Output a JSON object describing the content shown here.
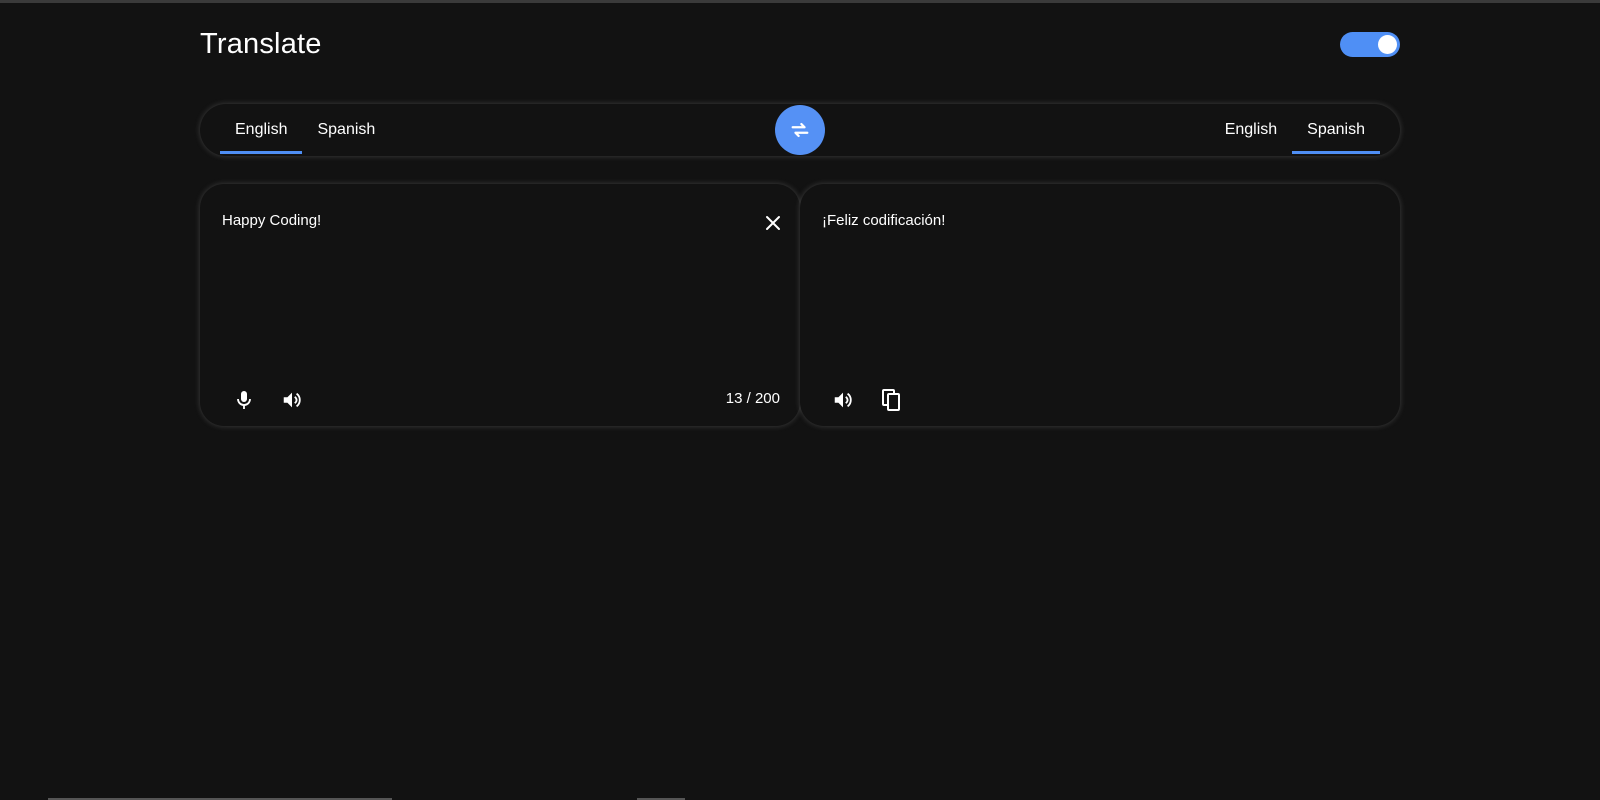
{
  "header": {
    "title": "Translate",
    "theme_toggle_on": true
  },
  "language_bar": {
    "source_languages": [
      {
        "label": "English",
        "active": true
      },
      {
        "label": "Spanish",
        "active": false
      }
    ],
    "target_languages": [
      {
        "label": "English",
        "active": false
      },
      {
        "label": "Spanish",
        "active": true
      }
    ]
  },
  "source_panel": {
    "text": "Happy Coding!",
    "char_count": "13 / 200"
  },
  "target_panel": {
    "text": "¡Feliz codificación!"
  },
  "icons": {
    "swap": "swap-arrows-icon",
    "clear": "close-icon",
    "mic": "microphone-icon",
    "speak": "speaker-icon",
    "copy": "copy-icon"
  },
  "colors": {
    "accent": "#4f8ff5",
    "background": "#121212",
    "text": "#ffffff"
  }
}
